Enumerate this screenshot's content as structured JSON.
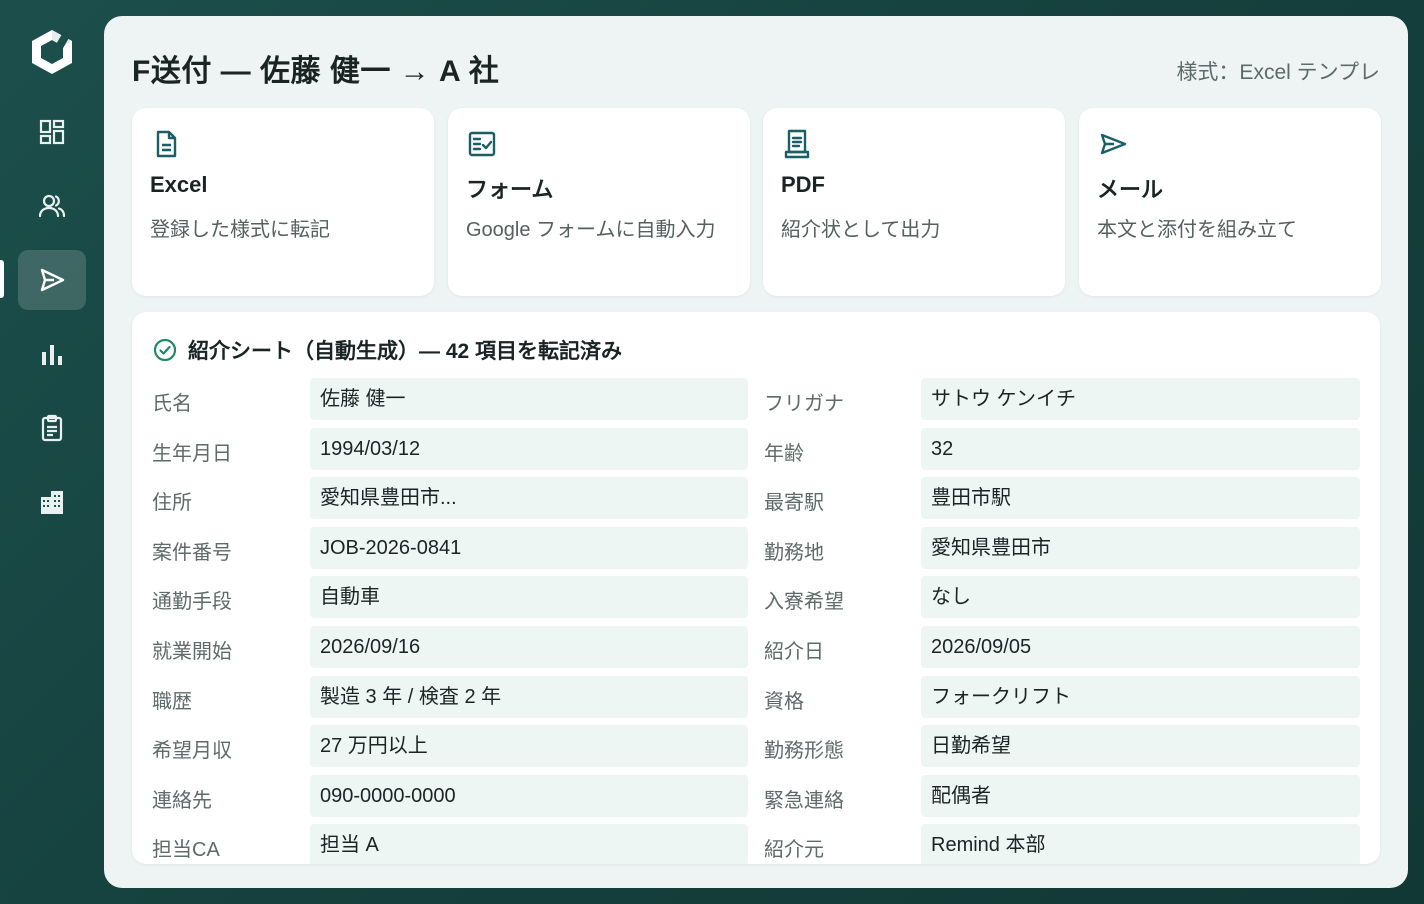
{
  "sidebar": {
    "logo": "app-logo",
    "items": [
      {
        "icon": "dashboard-icon",
        "active": false
      },
      {
        "icon": "people-icon",
        "active": false
      },
      {
        "icon": "send-icon",
        "active": true
      },
      {
        "icon": "bar-chart-icon",
        "active": false
      },
      {
        "icon": "clipboard-icon",
        "active": false
      },
      {
        "icon": "building-icon",
        "active": false
      }
    ]
  },
  "header": {
    "title": "F送付 — 佐藤 健一 → A 社",
    "format_label": "様式：Excel テンプレ"
  },
  "cards": [
    {
      "icon": "document-icon",
      "title": "Excel",
      "desc": "登録した様式に転記"
    },
    {
      "icon": "form-icon",
      "title": "フォーム",
      "desc": "Google フォームに自動入力"
    },
    {
      "icon": "receipt-icon",
      "title": "PDF",
      "desc": "紹介状として出力"
    },
    {
      "icon": "send-icon",
      "title": "メール",
      "desc": "本文と添付を組み立て"
    }
  ],
  "sheet": {
    "title": "紹介シート（自動生成）— 42 項目を転記済み",
    "rows": [
      {
        "l1": "氏名",
        "v1": "佐藤 健一",
        "l2": "フリガナ",
        "v2": "サトウ ケンイチ"
      },
      {
        "l1": "生年月日",
        "v1": "1994/03/12",
        "l2": "年齢",
        "v2": "32"
      },
      {
        "l1": "住所",
        "v1": "愛知県豊田市...",
        "l2": "最寄駅",
        "v2": "豊田市駅"
      },
      {
        "l1": "案件番号",
        "v1": "JOB-2026-0841",
        "l2": "勤務地",
        "v2": "愛知県豊田市"
      },
      {
        "l1": "通勤手段",
        "v1": "自動車",
        "l2": "入寮希望",
        "v2": "なし"
      },
      {
        "l1": "就業開始",
        "v1": "2026/09/16",
        "l2": "紹介日",
        "v2": "2026/09/05"
      },
      {
        "l1": "職歴",
        "v1": "製造 3 年 / 検査 2 年",
        "l2": "資格",
        "v2": "フォークリフト"
      },
      {
        "l1": "希望月収",
        "v1": "27 万円以上",
        "l2": "勤務形態",
        "v2": "日勤希望"
      },
      {
        "l1": "連絡先",
        "v1": "090-0000-0000",
        "l2": "緊急連絡",
        "v2": "配偶者"
      },
      {
        "l1": "担当CA",
        "v1": "担当 A",
        "l2": "紹介元",
        "v2": "Remind 本部"
      }
    ]
  }
}
